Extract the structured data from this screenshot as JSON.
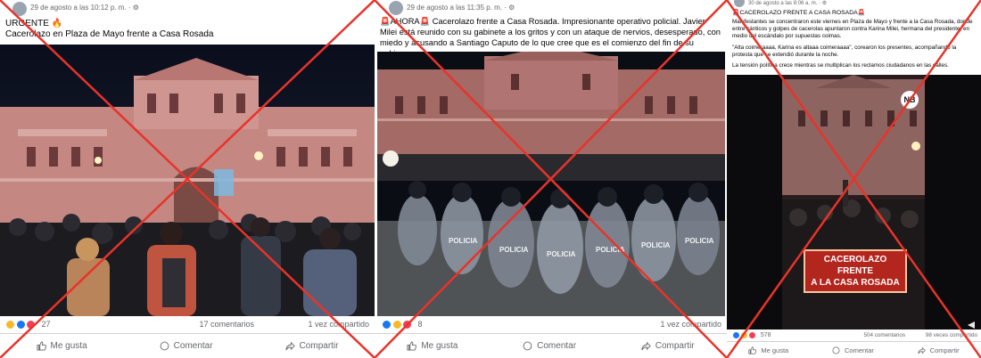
{
  "posts": [
    {
      "date": "29 de agosto a las 10:12 p. m. · ⚙",
      "text_line1": "URGENTE 🔥",
      "text_line2": "Cacerolazo en Plaza de Mayo frente a Casa Rosada",
      "reactions_count": "27",
      "comments": "17 comentarios",
      "shares": "1 vez compartido"
    },
    {
      "date": "29 de agosto a las 11:35 p. m. · ⚙",
      "text": "🚨AHORA🚨 Cacerolazo frente a Casa Rosada. Impresionante operativo policial. Javier Milei está reunido con su gabinete a los gritos y con un ataque de nervios, desesperado, con miedo y acusando a Santiago Caputo de lo que cree que es el comienzo del fin de su gobierno.",
      "reactions_count": "8",
      "comments": "",
      "shares": "1 vez compartido"
    },
    {
      "date": "30 de agosto a las 8:06 a. m. · ⚙",
      "headline": "🚨CACEROLAZO FRENTE A CASA ROSADA🚨",
      "bullet1": "Manifestantes se concentraron este viernes en Plaza de Mayo y frente a la Casa Rosada, donde entre cánticos y golpes de cacerolas apuntaron contra Karina Milei, hermana del presidente, en medio del escándalo por supuestas coimas.",
      "bullet2": "\"Alta coimeraaaa, Karina es altaaa coimeraaaa\", corearon los presentes, acompañando la protesta que se extendió durante la noche.",
      "bullet3": "La tensión política crece mientras se multiplican los reclamos ciudadanos en las calles.",
      "overlay_line1": "CACEROLAZO FRENTE",
      "overlay_line2": "A LA CASA ROSADA",
      "logo": "NB",
      "reactions_count": "578",
      "comments": "504 comentarios",
      "shares": "98 veces compartido"
    }
  ],
  "actions": {
    "like": "Me gusta",
    "comment": "Comentar",
    "share": "Compartir"
  },
  "colors": {
    "fake_cross": "#e8332a",
    "like_blue": "#1877f2",
    "love_red": "#f33e58",
    "haha_yellow": "#f7b928",
    "palace_pink": "#c98a86"
  }
}
